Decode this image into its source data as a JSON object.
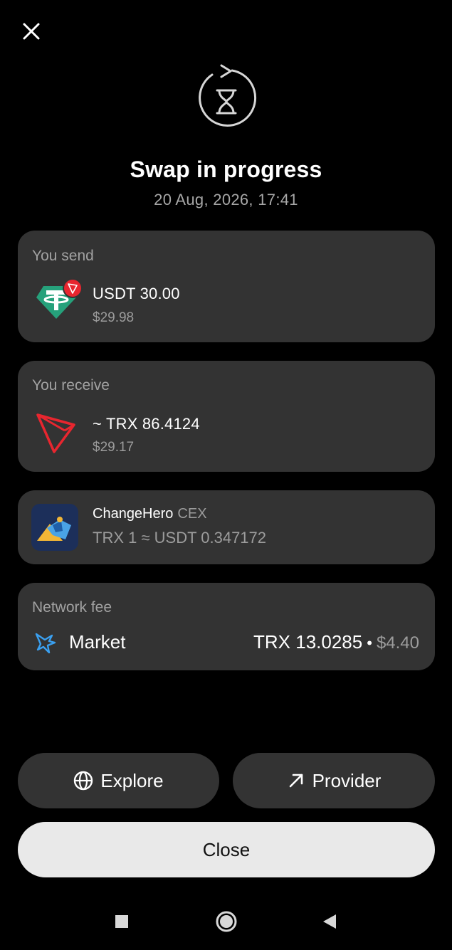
{
  "header": {
    "close_icon": "close-icon",
    "status_icon": "hourglass-refresh-icon",
    "title": "Swap in progress",
    "datetime": "20 Aug, 2026, 17:41"
  },
  "send": {
    "label": "You send",
    "icon": "usdt-icon",
    "badge_icon": "tron-badge-icon",
    "amount": "USDT 30.00",
    "fiat": "$29.98"
  },
  "receive": {
    "label": "You receive",
    "icon": "tron-icon",
    "amount": "~ TRX 86.4124",
    "fiat": "$29.17"
  },
  "provider": {
    "icon": "changehero-logo",
    "name": "ChangeHero",
    "type": "CEX",
    "rate": "TRX 1 ≈ USDT 0.347172"
  },
  "fee": {
    "label": "Network fee",
    "icon": "hummingbird-icon",
    "tier": "Market",
    "amount": "TRX 13.0285",
    "separator": "•",
    "fiat": "$4.40"
  },
  "actions": {
    "explore_label": "Explore",
    "explore_icon": "globe-icon",
    "provider_label": "Provider",
    "provider_icon": "arrow-up-right-icon",
    "close_label": "Close"
  },
  "navbar": {
    "recents_icon": "square-icon",
    "home_icon": "circle-icon",
    "back_icon": "triangle-back-icon"
  },
  "colors": {
    "background": "#000000",
    "card": "#333333",
    "muted_text": "#9c9c9c",
    "close_button": "#e9e9e9",
    "usdt_teal": "#26a17b",
    "tron_red": "#e8262f",
    "fee_blue": "#3aa0f0"
  }
}
